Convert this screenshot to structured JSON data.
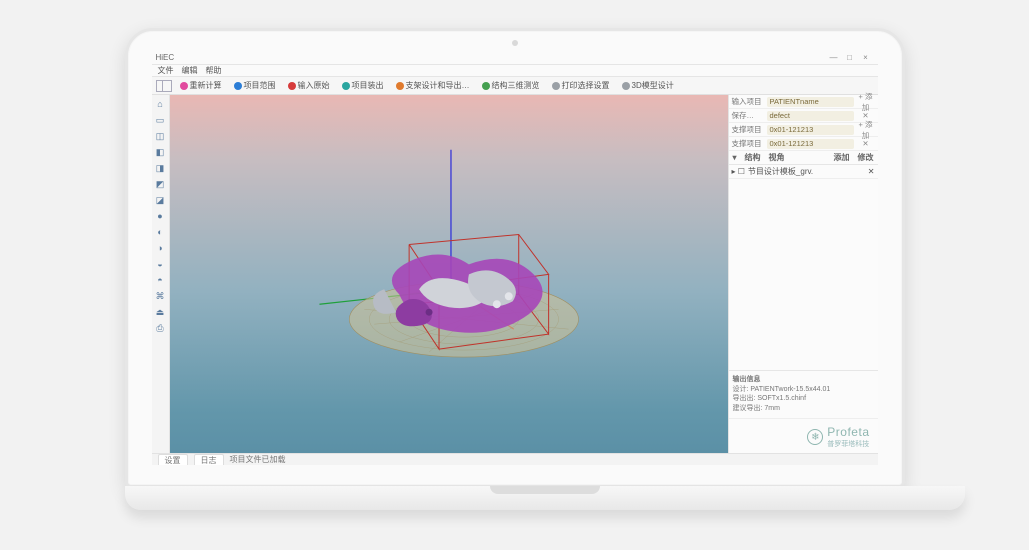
{
  "window": {
    "title": "HiEC",
    "minimize": "—",
    "maximize": "□",
    "close": "×"
  },
  "menu": {
    "file": "文件",
    "edit": "编辑",
    "help": "帮助"
  },
  "toolbar": [
    {
      "label": "重新计算"
    },
    {
      "label": "项目范围"
    },
    {
      "label": "输入原始"
    },
    {
      "label": "项目装出"
    },
    {
      "label": "支架设计和导出…"
    },
    {
      "label": "结构三维测览"
    },
    {
      "label": "打印选择设置"
    },
    {
      "label": "3D模型设计"
    }
  ],
  "toolbar_layout": "布局",
  "side_tools": [
    "⌂",
    "▭",
    "◫",
    "◧",
    "◨",
    "◩",
    "◪",
    "●",
    "◐",
    "◑",
    "◒",
    "◓",
    "⌘",
    "⏏",
    "⎙"
  ],
  "right": {
    "rows": [
      {
        "label": "输入项目",
        "value": "PATIENTname"
      },
      {
        "label": "保存…",
        "value": "defect"
      },
      {
        "label": "支撑项目",
        "value": "0x01-121213"
      },
      {
        "label": "支撑项目",
        "value": "0x01-121213"
      }
    ],
    "controls1": {
      "add": "+ 添加",
      "del": "✕"
    },
    "header2_a": "结构",
    "header2_b": "视角",
    "controls2": {
      "add": "添加",
      "mod": "修改"
    },
    "tree_item": "节目设计模板_grv.",
    "info_title": "输出信息",
    "info_l1": "设计: PATIENTwork-15.5x44.01",
    "info_l2": "导出出: SOFTx1.5.chinf",
    "info_l3": "建议导出: 7mm"
  },
  "logo": {
    "text": "Profeta",
    "sub": "普罗菲塔科技"
  },
  "status": {
    "tab1": "设置",
    "tab2": "日志",
    "text": "项目文件已加载"
  }
}
